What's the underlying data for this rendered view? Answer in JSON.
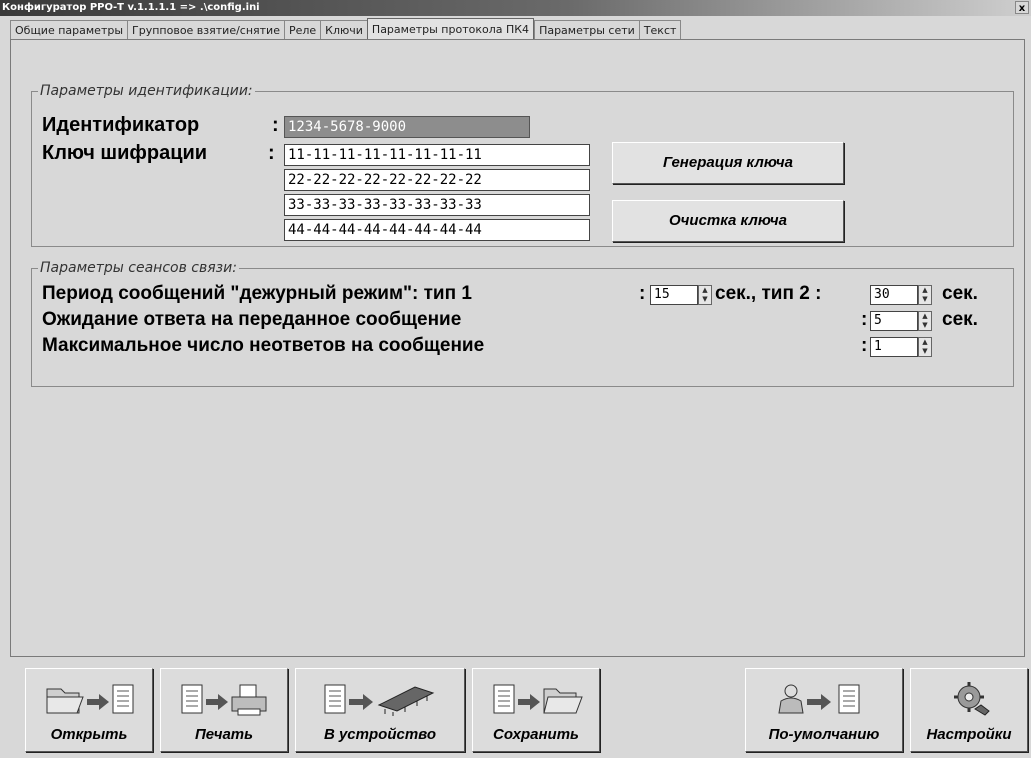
{
  "window": {
    "title": "Конфигуратор РРО-Т v.1.1.1.1  =>  .\\config.ini",
    "close_glyph": "x"
  },
  "tabs": [
    {
      "label": "Общие параметры",
      "active": false
    },
    {
      "label": "Групповое взятие/снятие",
      "active": false
    },
    {
      "label": "Реле",
      "active": false
    },
    {
      "label": "Ключи",
      "active": false
    },
    {
      "label": "Параметры протокола ПК4",
      "active": true
    },
    {
      "label": "Параметры сети",
      "active": false
    },
    {
      "label": "Текст",
      "active": false
    }
  ],
  "ident": {
    "legend": "Параметры идентификации:",
    "id_label": "Идентификатор",
    "colon": ":",
    "id_value": "1234-5678-9000",
    "key_label": "Ключ шифрации",
    "keys": [
      "11-11-11-11-11-11-11-11",
      "22-22-22-22-22-22-22-22",
      "33-33-33-33-33-33-33-33",
      "44-44-44-44-44-44-44-44"
    ],
    "generate_button": "Генерация ключа",
    "clear_button": "Очистка ключа"
  },
  "session": {
    "legend": "Параметры сеансов связи:",
    "period_label": "Период сообщений \"дежурный режим\": тип 1",
    "colon": ":",
    "type1_value": "15",
    "sec_type2_label": "сек., тип 2 :",
    "type2_value": "30",
    "sec_label": "сек.",
    "wait_label": "Ожидание ответа на переданное сообщение",
    "wait_value": "5",
    "max_label": "Максимальное число неответов на сообщение",
    "max_value": "1"
  },
  "toolbar": {
    "open": "Открыть",
    "print": "Печать",
    "to_device": "В устройство",
    "save": "Сохранить",
    "default": "По-умолчанию",
    "settings": "Настройки"
  },
  "icons": {
    "open": "folder-to-document-icon",
    "print": "document-to-printer-icon",
    "to_device": "document-to-chip-icon",
    "save": "document-to-folder-icon",
    "default": "engineer-to-document-icon",
    "settings": "gear-settings-icon"
  }
}
